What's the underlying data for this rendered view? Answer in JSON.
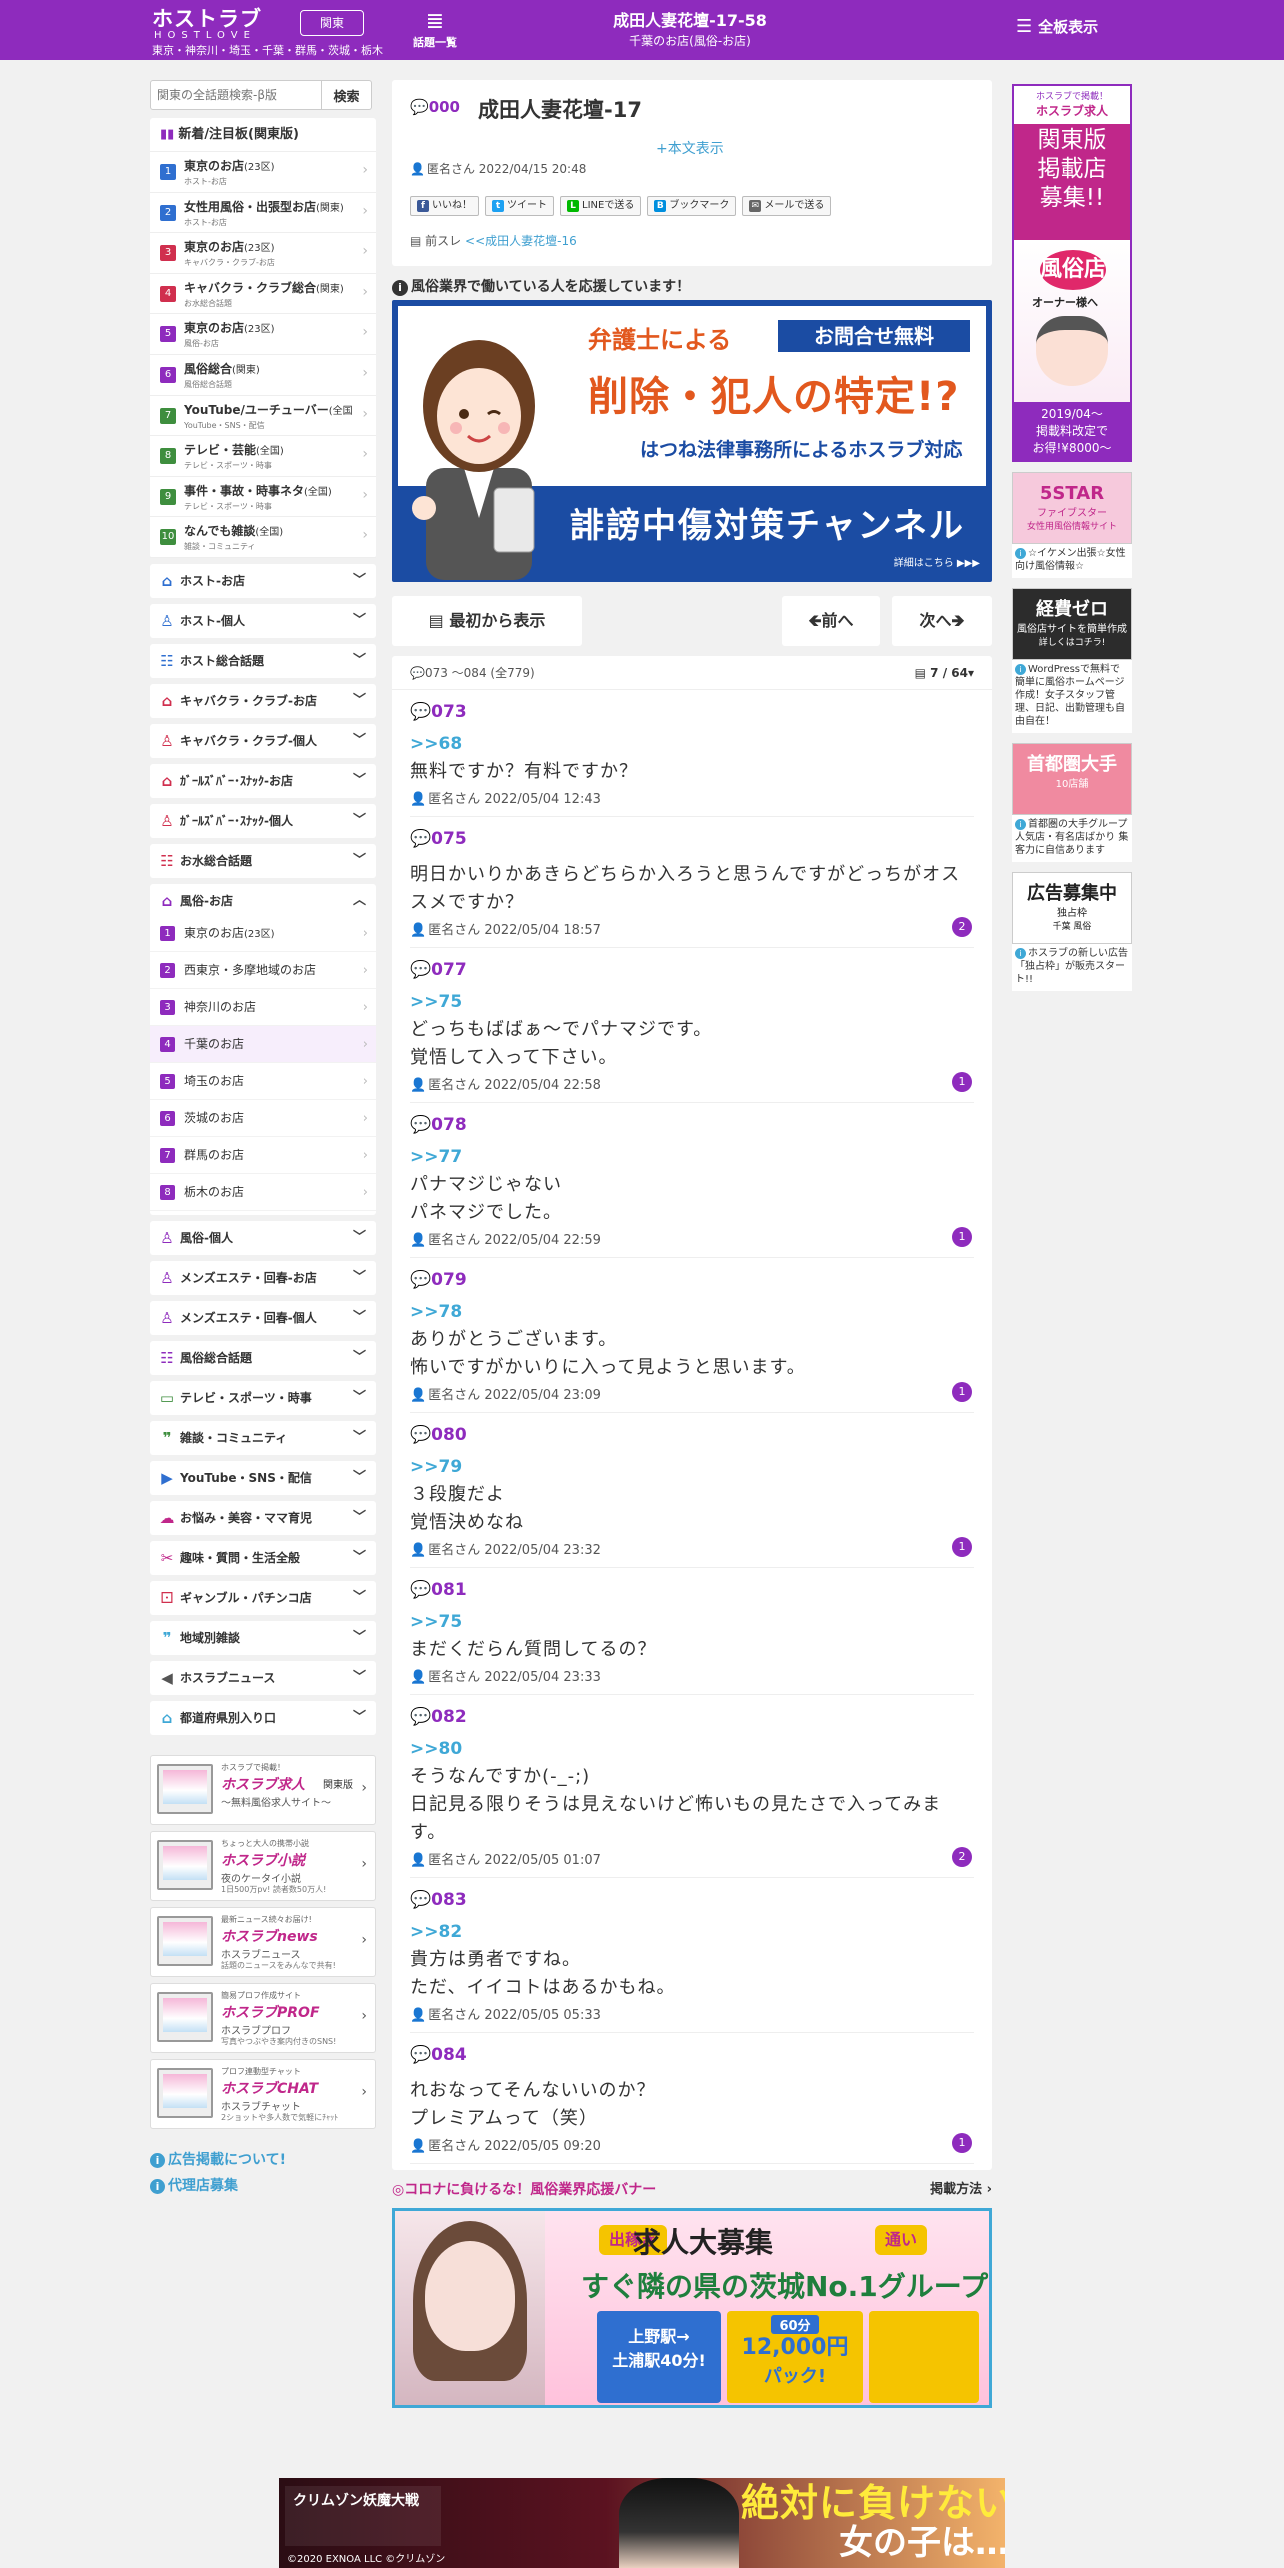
{
  "header": {
    "logo_jp": "ホストラブ",
    "logo_en": "HOSTLOVE",
    "areas": "東京・神奈川・埼玉・千葉・群馬・茨城・栃木",
    "region_button": "関東",
    "topics_glyph": "≣",
    "topics_label": "話題一覧",
    "thread_title": "成田人妻花壇-17-58",
    "thread_subtitle": "千葉のお店(風俗-お店)",
    "menu_label": "全板表示",
    "accent_color": "#8e2bbd"
  },
  "sidebar": {
    "search_placeholder": "関東の全話題検索-β版",
    "search_button": "検索",
    "new_boards_title": "新着/注目板(関東版)",
    "boards": [
      {
        "num": "1",
        "color": "#2f6fd0",
        "name": "東京のお店",
        "area": "(23区)",
        "sub": "ホスト-お店"
      },
      {
        "num": "2",
        "color": "#2f6fd0",
        "name": "女性用風俗・出張型お店",
        "area": "(関東)",
        "sub": "ホスト-お店"
      },
      {
        "num": "3",
        "color": "#d02f4e",
        "name": "東京のお店",
        "area": "(23区)",
        "sub": "キャバクラ・クラブ-お店"
      },
      {
        "num": "4",
        "color": "#d02f4e",
        "name": "キャバクラ・クラブ総合",
        "area": "(関東)",
        "sub": "お水総合話題"
      },
      {
        "num": "5",
        "color": "#8e2bbd",
        "name": "東京のお店",
        "area": "(23区)",
        "sub": "風俗-お店"
      },
      {
        "num": "6",
        "color": "#8e2bbd",
        "name": "風俗総合",
        "area": "(関東)",
        "sub": "風俗総合話題"
      },
      {
        "num": "7",
        "color": "#3e8e3e",
        "name": "YouTube/ユーチューバー",
        "area": "(全国)",
        "sub": "YouTube・SNS・配信"
      },
      {
        "num": "8",
        "color": "#3e8e3e",
        "name": "テレビ・芸能",
        "area": "(全国)",
        "sub": "テレビ・スポーツ・時事"
      },
      {
        "num": "9",
        "color": "#3e8e3e",
        "name": "事件・事故・時事ネタ",
        "area": "(全国)",
        "sub": "テレビ・スポーツ・時事"
      },
      {
        "num": "10",
        "color": "#3e8e3e",
        "name": "なんでも雑談",
        "area": "(全国)",
        "sub": "雑談・コミュニティ"
      }
    ],
    "categories_top": [
      {
        "label": "ホスト-お店",
        "icon": "⌂",
        "color": "#2f6fd0"
      },
      {
        "label": "ホスト-個人",
        "icon": "♙",
        "color": "#2f6fd0"
      },
      {
        "label": "ホスト総合話題",
        "icon": "☷",
        "color": "#2f6fd0"
      },
      {
        "label": "キャバクラ・クラブ-お店",
        "icon": "⌂",
        "color": "#d02f4e"
      },
      {
        "label": "キャバクラ・クラブ-個人",
        "icon": "♙",
        "color": "#d02f4e"
      },
      {
        "label": "ｶﾞｰﾙｽﾞﾊﾞｰ･ｽﾅｯｸ-お店",
        "icon": "⌂",
        "color": "#d02f4e"
      },
      {
        "label": "ｶﾞｰﾙｽﾞﾊﾞｰ･ｽﾅｯｸ-個人",
        "icon": "♙",
        "color": "#d02f4e"
      },
      {
        "label": "お水総合話題",
        "icon": "☷",
        "color": "#d02f4e"
      }
    ],
    "open_category": {
      "label": "風俗-お店",
      "icon": "⌂",
      "color": "#8e2bbd",
      "chevron": "︿"
    },
    "open_sub_items": [
      {
        "num": "1",
        "label": "東京のお店",
        "area": "(23区)"
      },
      {
        "num": "2",
        "label": "西東京・多摩地域のお店",
        "area": ""
      },
      {
        "num": "3",
        "label": "神奈川のお店",
        "area": ""
      },
      {
        "num": "4",
        "label": "千葉のお店",
        "area": ""
      },
      {
        "num": "5",
        "label": "埼玉のお店",
        "area": ""
      },
      {
        "num": "6",
        "label": "茨城のお店",
        "area": ""
      },
      {
        "num": "7",
        "label": "群馬のお店",
        "area": ""
      },
      {
        "num": "8",
        "label": "栃木のお店",
        "area": ""
      }
    ],
    "categories_bottom": [
      {
        "label": "風俗-個人",
        "icon": "♙",
        "color": "#8e2bbd"
      },
      {
        "label": "メンズエステ・回春-お店",
        "icon": "♙",
        "color": "#8e2bbd"
      },
      {
        "label": "メンズエステ・回春-個人",
        "icon": "♙",
        "color": "#8e2bbd"
      },
      {
        "label": "風俗総合話題",
        "icon": "☷",
        "color": "#8e2bbd"
      },
      {
        "label": "テレビ・スポーツ・時事",
        "icon": "▭",
        "color": "#3e8e3e"
      },
      {
        "label": "雑談・コミュニティ",
        "icon": "❞",
        "color": "#3e8e3e"
      },
      {
        "label": "YouTube・SNS・配信",
        "icon": "▶",
        "color": "#2f6fd0"
      },
      {
        "label": "お悩み・美容・ママ育児",
        "icon": "☁",
        "color": "#c0278a"
      },
      {
        "label": "趣味・質問・生活全般",
        "icon": "✂",
        "color": "#c0278a"
      },
      {
        "label": "ギャンブル・パチンコ店",
        "icon": "⚀",
        "color": "#d02f4e"
      },
      {
        "label": "地域別雑談",
        "icon": "❞",
        "color": "#3fa8d6"
      },
      {
        "label": "ホスラブニュース",
        "icon": "◀",
        "color": "#555555"
      },
      {
        "label": "都道府県別入り口",
        "icon": "⌂",
        "color": "#3fa8d6"
      }
    ],
    "category_chevron": "﹀",
    "promos": [
      {
        "tag": "ホスラブで掲載！",
        "brand": "ホスラブ求人",
        "right": "関東版",
        "cap": "～無料風俗求人サイト～",
        "cap2": ""
      },
      {
        "tag": "ちょっと大人の携帯小説",
        "brand": "ホスラブ小説",
        "right": "",
        "cap": "夜のケータイ小説",
        "cap2": "1日500万pv! 読者数50万人!"
      },
      {
        "tag": "最新ニュース続々お届け!",
        "brand": "ホスラブnews",
        "right": "",
        "cap": "ホスラブニュース",
        "cap2": "話題のニュースをみんなで共有!"
      },
      {
        "tag": "簡易プロフ作成サイト",
        "brand": "ホスラブPROF",
        "right": "",
        "cap": "ホスラブプロフ",
        "cap2": "写真やつぶやき案内付きのSNS!"
      },
      {
        "tag": "プロフ連動型チャット",
        "brand": "ホスラブCHAT",
        "right": "",
        "cap": "ホスラブチャット",
        "cap2": "2ショットや多人数で気軽にﾁｬｯﾄ"
      }
    ],
    "links": [
      "広告掲載について!",
      "代理店募集"
    ]
  },
  "thread": {
    "first_no": "000",
    "title": "成田人妻花壇-17",
    "show_body": "+本文表示",
    "author": "匿名さん",
    "date": "2022/04/15 20:48",
    "share_buttons": [
      {
        "label": "いいね！",
        "icon": "f",
        "color": "#3b5998"
      },
      {
        "label": "ツイート",
        "icon": "t",
        "color": "#1da1f2"
      },
      {
        "label": "LINEで送る",
        "icon": "L",
        "color": "#00b900"
      },
      {
        "label": "ブックマーク",
        "icon": "B",
        "color": "#008fde"
      },
      {
        "label": "メールで送る",
        "icon": "✉",
        "color": "#666666"
      }
    ],
    "prev_label": "前スレ",
    "prev_link": "<<成田人妻花壇-16",
    "support_label": "風俗業界で働いている人を応援しています！"
  },
  "lawyer_banner": {
    "line1": "弁護士による",
    "badge": "お問合せ無料",
    "line2": "削除・犯人の特定!?",
    "line3": "はつね法律事務所によるホスラブ対応",
    "line4": "誹謗中傷対策チャンネル",
    "more": "詳細はこちら ▶▶▶"
  },
  "nav": {
    "from_start": "最初から表示",
    "prev": "前へ",
    "next": "次へ"
  },
  "posts_meta": {
    "range": "073 ～084 (全779)",
    "page": "7 / 64"
  },
  "posts": [
    {
      "no": "073",
      "reply": ">>68",
      "body": "無料ですか？有料ですか？",
      "author": "匿名さん",
      "date": "2022/05/04 12:43",
      "count": ""
    },
    {
      "no": "075",
      "reply": "",
      "body": "明日かいりかあきらどちらか入ろうと思うんですがどっちがオススメですか？",
      "author": "匿名さん",
      "date": "2022/05/04 18:57",
      "count": "2"
    },
    {
      "no": "077",
      "reply": ">>75",
      "body": "どっちもばばぁ〜でパナマジです。\n覚悟して入って下さい。",
      "author": "匿名さん",
      "date": "2022/05/04 22:58",
      "count": "1"
    },
    {
      "no": "078",
      "reply": ">>77",
      "body": "パナマジじゃない\nパネマジでした。",
      "author": "匿名さん",
      "date": "2022/05/04 22:59",
      "count": "1"
    },
    {
      "no": "079",
      "reply": ">>78",
      "body": "ありがとうございます。\n怖いですがかいりに入って見ようと思います。",
      "author": "匿名さん",
      "date": "2022/05/04 23:09",
      "count": "1"
    },
    {
      "no": "080",
      "reply": ">>79",
      "body": "３段腹だよ\n覚悟決めなね",
      "author": "匿名さん",
      "date": "2022/05/04 23:32",
      "count": "1"
    },
    {
      "no": "081",
      "reply": ">>75",
      "body": "まだくだらん質問してるの？",
      "author": "匿名さん",
      "date": "2022/05/04 23:33",
      "count": ""
    },
    {
      "no": "082",
      "reply": ">>80",
      "body": "そうなんですか(-_-;)\n日記見る限りそうは見えないけど怖いもの見たさで入ってみます。",
      "author": "匿名さん",
      "date": "2022/05/05 01:07",
      "count": "2"
    },
    {
      "no": "083",
      "reply": ">>82",
      "body": "貴方は勇者ですね。\nただ、イイコトはあるかもね。",
      "author": "匿名さん",
      "date": "2022/05/05 05:33",
      "count": ""
    },
    {
      "no": "084",
      "reply": "",
      "body": "れおなってそんないいのか？\nプレミアムって（笑）",
      "author": "匿名さん",
      "date": "2022/05/05 09:20",
      "count": "1"
    }
  ],
  "corona": {
    "label": "◎コロナに負けるな！風俗業界応援バナー",
    "post_method": "掲載方法"
  },
  "recruit_banner": {
    "tag1": "出稼ぎ",
    "headline": "求人大募集",
    "tag2": "通い",
    "line2": "すぐ隣の県の茨城No.1グループ",
    "station": "上野駅→\n土浦駅40分!",
    "time": "60分",
    "price": "12,000円",
    "pack": "パック!"
  },
  "right_ads": {
    "big_hdr": "ホスラブで掲載！",
    "big_brand": "ホスラブ求人",
    "big_pink": "関東版\n掲載店\n募集!!",
    "big_stamp": "風俗店",
    "big_owner": "オーナー様へ",
    "big_foot": "2019/04〜\n掲載料改定で\nお得!¥8000〜",
    "smalls": [
      {
        "img_text": "5STAR",
        "img_sub": "ファイブスター",
        "img_sub2": "女性用風俗情報サイト",
        "bg": "#f6c9dc",
        "fg": "#c0278a",
        "caption": "☆イケメン出張☆女性向け風俗情報☆"
      },
      {
        "img_text": "経費ゼロ",
        "img_sub": "風俗店サイトを簡単作成",
        "img_sub2": "詳しくはコチラ!",
        "bg": "#2c2c2c",
        "fg": "#ffffff",
        "caption": "WordPressで無料で簡単に風俗ホームページ作成！女子スタッフ管理、日記、出勤管理も自由自在！"
      },
      {
        "img_text": "首都圏大手",
        "img_sub": "10店舗",
        "img_sub2": "",
        "bg": "#f08aa0",
        "fg": "#ffffff",
        "caption": "首都圏の大手グループ 人気店・有名店ばかり 集客力に自信あります"
      },
      {
        "img_text": "広告募集中",
        "img_sub": "独占枠",
        "img_sub2": "千葉 風俗",
        "bg": "#ffffff",
        "fg": "#222222",
        "caption": "ホスラブの新しい広告「独占枠」が販売スタート!!"
      }
    ]
  },
  "bottom_ad": {
    "logo": "クリムゾン妖魔大戦",
    "copyright": "©2020 EXNOA LLC ©クリムゾン",
    "catch1": "絶対に負けない",
    "catch2": "女の子は…"
  }
}
